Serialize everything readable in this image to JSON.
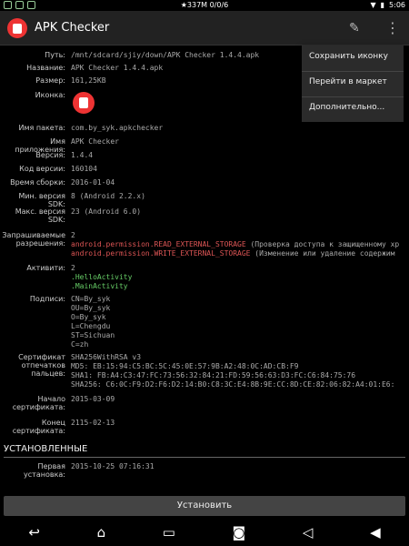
{
  "status": {
    "center_text": "★337M 0/0/6",
    "time": "5:06"
  },
  "appbar": {
    "title": "APK Checker"
  },
  "menu": [
    "Сохранить иконку",
    "Перейти в маркет",
    "Дополнительно..."
  ],
  "fields": {
    "path": {
      "label": "Путь:",
      "value": "/mnt/sdcard/sjiy/down/APK Checker 1.4.4.apk"
    },
    "name": {
      "label": "Название:",
      "value": "APK Checker 1.4.4.apk"
    },
    "size": {
      "label": "Размер:",
      "value": "161,25KB"
    },
    "icon": {
      "label": "Иконка:"
    },
    "package": {
      "label": "Имя пакета:",
      "value": "com.by_syk.apkchecker"
    },
    "app_name": {
      "label": "Имя приложения:",
      "value": "APK Checker"
    },
    "version": {
      "label": "Версия:",
      "value": "1.4.4"
    },
    "version_code": {
      "label": "Код версии:",
      "value": "160104"
    },
    "build_time": {
      "label": "Время сборки:",
      "value": "2016-01-04"
    },
    "min_sdk": {
      "label": "Мин. версия SDK:",
      "value": "8 (Android 2.2.x)"
    },
    "max_sdk": {
      "label": "Макс. версия SDK:",
      "value": "23 (Android 6.0)"
    },
    "permissions": {
      "label": "Запрашиваемые разрешения:",
      "count": "2",
      "items": [
        {
          "name": "android.permission.READ_EXTERNAL_STORAGE",
          "desc": " (Проверка доступа к защищенному хр"
        },
        {
          "name": "android.permission.WRITE_EXTERNAL_STORAGE",
          "desc": " (Изменение или удаление содержим"
        }
      ]
    },
    "activities": {
      "label": "Активити:",
      "count": "2",
      "items": [
        ".HelloActivity",
        ".MainActivity"
      ]
    },
    "signatures": {
      "label": "Подписи:",
      "lines": [
        "CN=By_syk",
        "OU=By_syk",
        "O=By_syk",
        "L=Chengdu",
        "ST=Sichuan",
        "C=zh"
      ]
    },
    "certificate": {
      "label": "Сертификат отпечатков пальцев:",
      "lines": [
        "SHA256WithRSA v3",
        "MD5: EB:15:94:C5:BC:5C:45:0E:57:9B:A2:48:0C:AD:CB:F9",
        "SHA1: FB:A4:C3:47:FC:73:56:32:84:21:FD:59:56:63:D3:FC:C6:84:75:76",
        "SHA256: C6:0C:F9:D2:F6:D2:14:B0:C8:3C:E4:8B:9E:CC:8D:CE:82:06:82:A4:01:E6:"
      ]
    },
    "cert_start": {
      "label": "Начало сертификата:",
      "value": "2015-03-09"
    },
    "cert_end": {
      "label": "Конец сертификата:",
      "value": "2115-02-13"
    }
  },
  "section_installed": "УСТАНОВЛЕННЫЕ",
  "first_install": {
    "label": "Первая установка:",
    "value": "2015-10-25 07:16:31"
  },
  "install_button": "Установить"
}
